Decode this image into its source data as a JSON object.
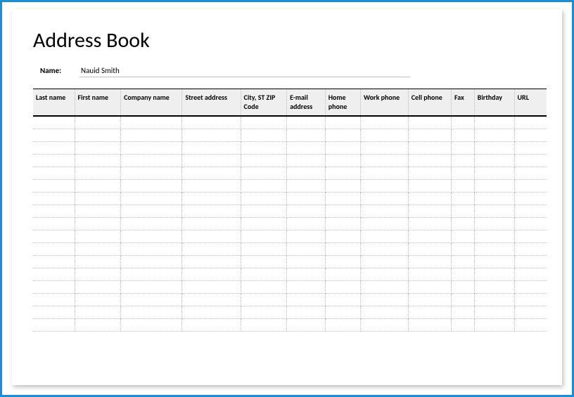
{
  "title": "Address Book",
  "name_label": "Name:",
  "name_value": "Nauid Smith",
  "columns": {
    "last_name": "Last name",
    "first_name": "First name",
    "company_name": "Company name",
    "street_address": "Street address",
    "city_st_zip": "City, ST  ZIP Code",
    "email": "E-mail address",
    "home_phone": "Home phone",
    "work_phone": "Work phone",
    "cell_phone": "Cell phone",
    "fax": "Fax",
    "birthday": "Birthday",
    "url": "URL"
  },
  "rows": [
    {},
    {},
    {},
    {},
    {},
    {},
    {},
    {},
    {},
    {},
    {},
    {},
    {},
    {},
    {},
    {},
    {}
  ]
}
